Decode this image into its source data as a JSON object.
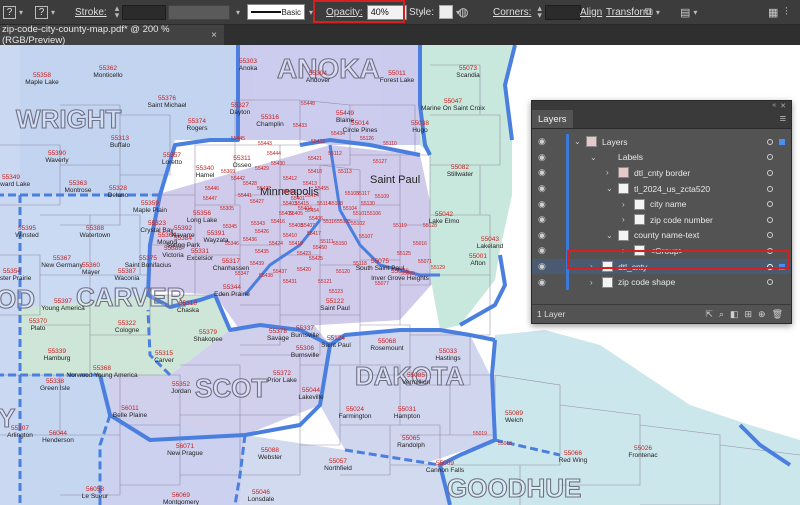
{
  "toolbar": {
    "q1": "?",
    "q2": "?",
    "stroke_label": "Stroke:",
    "stroke_style": "Basic",
    "opacity_label": "Opacity:",
    "opacity_value": "40%",
    "style_label": "Style:",
    "corners_label": "Corners:",
    "align_label": "Align",
    "transform_label": "Transform"
  },
  "tab": {
    "title": "zip-code-city-county-map.pdf* @ 200 % (RGB/Preview)",
    "close": "×"
  },
  "map": {
    "counties": [
      "ANOKA",
      "WRIGHT",
      "CARVER",
      "SCOT",
      "DAKOTA",
      "GOODHUE",
      "OD",
      "Y"
    ],
    "cities": [
      "Minneapolis",
      "Saint Paul"
    ],
    "zips": [
      {
        "zip": "55303",
        "name": "Anoka"
      },
      {
        "zip": "55304",
        "name": "Andover"
      },
      {
        "zip": "55011",
        "name": "Forest Lake"
      },
      {
        "zip": "55073",
        "name": "Scandia"
      },
      {
        "zip": "55362",
        "name": "Monticello"
      },
      {
        "zip": "55358",
        "name": "Maple Lake"
      },
      {
        "zip": "55376",
        "name": "Saint Michael"
      },
      {
        "zip": "55374",
        "name": "Rogers"
      },
      {
        "zip": "55327",
        "name": "Dayton"
      },
      {
        "zip": "55316",
        "name": "Champlin"
      },
      {
        "zip": "55449",
        "name": "Blaine"
      },
      {
        "zip": "55014",
        "name": "Circle Pines"
      },
      {
        "zip": "55038",
        "name": "Hugo"
      },
      {
        "zip": "55047",
        "name": "Marine On Saint Croix"
      },
      {
        "zip": "55313",
        "name": "Buffalo"
      },
      {
        "zip": "55390",
        "name": "Waverly"
      },
      {
        "zip": "55357",
        "name": "Loretto"
      },
      {
        "zip": "55340",
        "name": "Hamel"
      },
      {
        "zip": "55311",
        "name": "Osseo"
      },
      {
        "zip": "55349",
        "name": "Howard Lake"
      },
      {
        "zip": "55363",
        "name": "Montrose"
      },
      {
        "zip": "55328",
        "name": "Delano"
      },
      {
        "zip": "55359",
        "name": "Maple Plain"
      },
      {
        "zip": "55356",
        "name": "Long Lake"
      },
      {
        "zip": "55395",
        "name": "Winsted"
      },
      {
        "zip": "55388",
        "name": "Watertown"
      },
      {
        "zip": "55364",
        "name": "Mound"
      },
      {
        "zip": "55391",
        "name": "Wayzata"
      },
      {
        "zip": "55082",
        "name": "Stillwater"
      },
      {
        "zip": "55042",
        "name": "Lake Elmo"
      },
      {
        "zip": "55043",
        "name": "Lakeland"
      },
      {
        "zip": "55001",
        "name": "Afton"
      },
      {
        "zip": "55354",
        "name": "Lester Prairie"
      },
      {
        "zip": "55367",
        "name": "New Germany"
      },
      {
        "zip": "55360",
        "name": "Mayer"
      },
      {
        "zip": "55387",
        "name": "Waconia"
      },
      {
        "zip": "55375",
        "name": "Saint Bonifacius"
      },
      {
        "zip": "55397",
        "name": "Young America"
      },
      {
        "zip": "55370",
        "name": "Plato"
      },
      {
        "zip": "55322",
        "name": "Cologne"
      },
      {
        "zip": "55318",
        "name": "Chaska"
      },
      {
        "zip": "55317",
        "name": "Chanhassen"
      },
      {
        "zip": "55344",
        "name": "Eden Prairie"
      },
      {
        "zip": "55379",
        "name": "Shakopee"
      },
      {
        "zip": "55378",
        "name": "Savage"
      },
      {
        "zip": "55337",
        "name": "Burnsville"
      },
      {
        "zip": "55306",
        "name": "Burnsville"
      },
      {
        "zip": "55122",
        "name": "Saint Paul"
      },
      {
        "zip": "55124",
        "name": "Saint Paul"
      },
      {
        "zip": "55068",
        "name": "Rosemount"
      },
      {
        "zip": "55033",
        "name": "Hastings"
      },
      {
        "zip": "55339",
        "name": "Hamburg"
      },
      {
        "zip": "55315",
        "name": "Carver"
      },
      {
        "zip": "55368",
        "name": "Norwood Young America"
      },
      {
        "zip": "55338",
        "name": "Green Isle"
      },
      {
        "zip": "55352",
        "name": "Jordan"
      },
      {
        "zip": "55372",
        "name": "Prior Lake"
      },
      {
        "zip": "55044",
        "name": "Lakeville"
      },
      {
        "zip": "55024",
        "name": "Farmington"
      },
      {
        "zip": "55031",
        "name": "Hampton"
      },
      {
        "zip": "55085",
        "name": "Vermillion"
      },
      {
        "zip": "55307",
        "name": "Arlington"
      },
      {
        "zip": "56044",
        "name": "Henderson"
      },
      {
        "zip": "56011",
        "name": "Belle Plaine"
      },
      {
        "zip": "55065",
        "name": "Randolph"
      },
      {
        "zip": "55089",
        "name": "Welch"
      },
      {
        "zip": "56071",
        "name": "New Prague"
      },
      {
        "zip": "55088",
        "name": "Webster"
      },
      {
        "zip": "55057",
        "name": "Northfield"
      },
      {
        "zip": "55009",
        "name": "Cannon Falls"
      },
      {
        "zip": "55066",
        "name": "Red Wing"
      },
      {
        "zip": "55026",
        "name": "Frontenac"
      },
      {
        "zip": "56058",
        "name": "Le Sueur"
      },
      {
        "zip": "56069",
        "name": "Montgomery"
      },
      {
        "zip": "55046",
        "name": "Lonsdale"
      },
      {
        "zip": "55129",
        "name": ""
      },
      {
        "zip": "55125",
        "name": ""
      },
      {
        "zip": "55128",
        "name": ""
      },
      {
        "zip": "55127",
        "name": ""
      },
      {
        "zip": "55126",
        "name": ""
      },
      {
        "zip": "55110",
        "name": ""
      },
      {
        "zip": "55433",
        "name": ""
      },
      {
        "zip": "55448",
        "name": ""
      },
      {
        "zip": "55443",
        "name": ""
      },
      {
        "zip": "55445",
        "name": ""
      },
      {
        "zip": "55446",
        "name": ""
      },
      {
        "zip": "55442",
        "name": ""
      },
      {
        "zip": "55447",
        "name": ""
      },
      {
        "zip": "55441",
        "name": ""
      },
      {
        "zip": "55305",
        "name": ""
      },
      {
        "zip": "55345",
        "name": ""
      },
      {
        "zip": "55343",
        "name": ""
      },
      {
        "zip": "55346",
        "name": ""
      },
      {
        "zip": "55347",
        "name": ""
      },
      {
        "zip": "55331",
        "name": "Excelsior"
      },
      {
        "zip": "55386",
        "name": "Victoria"
      },
      {
        "zip": "55384",
        "name": "Spring Park"
      },
      {
        "zip": "55392",
        "name": "Navarre"
      },
      {
        "zip": "55323",
        "name": "Crystal Bay"
      },
      {
        "zip": "55077",
        "name": ""
      },
      {
        "zip": "55076",
        "name": "Inver Grove Heights"
      },
      {
        "zip": "55121",
        "name": ""
      },
      {
        "zip": "55123",
        "name": ""
      },
      {
        "zip": "55120",
        "name": ""
      },
      {
        "zip": "55118",
        "name": ""
      },
      {
        "zip": "55075",
        "name": "South Saint Paul"
      },
      {
        "zip": "55071",
        "name": ""
      },
      {
        "zip": "55016",
        "name": ""
      },
      {
        "zip": "55055",
        "name": ""
      },
      {
        "zip": "55119",
        "name": ""
      },
      {
        "zip": "55109",
        "name": ""
      },
      {
        "zip": "55117",
        "name": ""
      },
      {
        "zip": "55112",
        "name": ""
      },
      {
        "zip": "55113",
        "name": ""
      },
      {
        "zip": "55418",
        "name": ""
      },
      {
        "zip": "55421",
        "name": ""
      },
      {
        "zip": "55432",
        "name": ""
      },
      {
        "zip": "55434",
        "name": ""
      },
      {
        "zip": "55430",
        "name": ""
      },
      {
        "zip": "55429",
        "name": ""
      },
      {
        "zip": "55428",
        "name": ""
      },
      {
        "zip": "55427",
        "name": ""
      },
      {
        "zip": "55422",
        "name": ""
      },
      {
        "zip": "55426",
        "name": ""
      },
      {
        "zip": "55416",
        "name": ""
      },
      {
        "zip": "55405",
        "name": ""
      },
      {
        "zip": "55410",
        "name": ""
      },
      {
        "zip": "55424",
        "name": ""
      },
      {
        "zip": "55435",
        "name": ""
      },
      {
        "zip": "55439",
        "name": ""
      },
      {
        "zip": "55436",
        "name": ""
      },
      {
        "zip": "55438",
        "name": ""
      },
      {
        "zip": "55437",
        "name": ""
      },
      {
        "zip": "55431",
        "name": ""
      },
      {
        "zip": "55420",
        "name": ""
      },
      {
        "zip": "55425",
        "name": ""
      },
      {
        "zip": "55423",
        "name": ""
      },
      {
        "zip": "55419",
        "name": ""
      },
      {
        "zip": "55417",
        "name": ""
      },
      {
        "zip": "55450",
        "name": ""
      },
      {
        "zip": "55111",
        "name": ""
      },
      {
        "zip": "55150",
        "name": ""
      },
      {
        "zip": "55116",
        "name": ""
      },
      {
        "zip": "55105",
        "name": ""
      },
      {
        "zip": "55104",
        "name": ""
      },
      {
        "zip": "55102",
        "name": ""
      },
      {
        "zip": "55107",
        "name": ""
      },
      {
        "zip": "55106",
        "name": ""
      },
      {
        "zip": "55130",
        "name": ""
      },
      {
        "zip": "55101",
        "name": ""
      },
      {
        "zip": "55103",
        "name": ""
      },
      {
        "zip": "55108",
        "name": ""
      },
      {
        "zip": "55114",
        "name": ""
      },
      {
        "zip": "55414",
        "name": ""
      },
      {
        "zip": "55413",
        "name": ""
      },
      {
        "zip": "55412",
        "name": ""
      },
      {
        "zip": "55411",
        "name": ""
      },
      {
        "zip": "55401",
        "name": ""
      },
      {
        "zip": "55403",
        "name": ""
      },
      {
        "zip": "55404",
        "name": ""
      },
      {
        "zip": "55406",
        "name": ""
      },
      {
        "zip": "55407",
        "name": ""
      },
      {
        "zip": "55408",
        "name": ""
      },
      {
        "zip": "55409",
        "name": ""
      },
      {
        "zip": "55454",
        "name": ""
      },
      {
        "zip": "55455",
        "name": ""
      },
      {
        "zip": "55415",
        "name": ""
      },
      {
        "zip": "55444",
        "name": ""
      },
      {
        "zip": "55369",
        "name": ""
      },
      {
        "zip": "55018",
        "name": ""
      },
      {
        "zip": "55019",
        "name": ""
      }
    ]
  },
  "layers": {
    "tab": "Layers",
    "footer_count": "1 Layer",
    "rows": [
      {
        "label": "Layers"
      },
      {
        "label": "Labels"
      },
      {
        "label": "dtl_cnty border"
      },
      {
        "label": "tl_2024_us_zcta520"
      },
      {
        "label": "city name"
      },
      {
        "label": "zip code number"
      },
      {
        "label": "county name-text"
      },
      {
        "label": "<Group>"
      },
      {
        "label": "dtl_cnty"
      },
      {
        "label": "zip code shape"
      }
    ]
  },
  "colors": {
    "highlight": "#d61f1f",
    "selection": "#4a8df0",
    "county_border": "#4a7fe0",
    "zip_label": "#c82020"
  }
}
